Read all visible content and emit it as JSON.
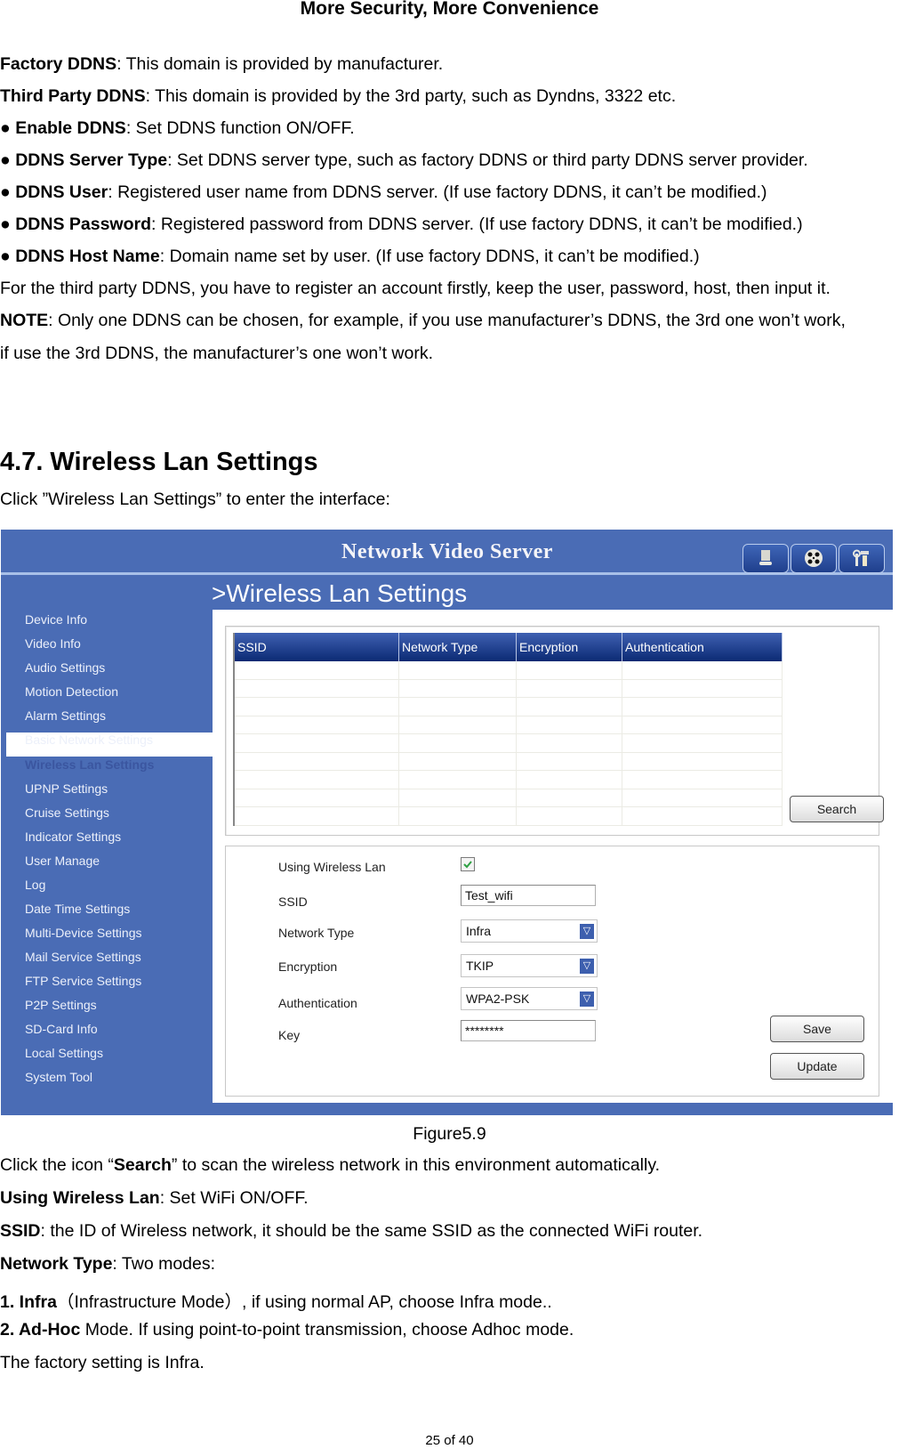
{
  "document": {
    "header": "More Security, More Convenience",
    "intro_paragraphs": [
      {
        "bold": "Factory DDNS",
        "text": ": This domain is provided by manufacturer."
      },
      {
        "bold": "Third Party DDNS",
        "text": ": This domain is provided by the 3rd party, such as Dyndns, 3322 etc."
      },
      {
        "bullet": "●",
        "bold": "Enable DDNS",
        "text": ": Set DDNS function ON/OFF."
      },
      {
        "bullet": "●",
        "bold": "DDNS Server Type",
        "text": ": Set DDNS server type, such as factory DDNS or third party DDNS server provider."
      },
      {
        "bullet": "●",
        "bold": "DDNS User",
        "text": ": Registered user name from DDNS server. (If use factory DDNS, it can’t be modified.)"
      },
      {
        "bullet": "●",
        "bold": "DDNS Password",
        "text": ": Registered password from DDNS server. (If use factory DDNS, it can’t be modified.)"
      },
      {
        "bullet": "●",
        "bold": "DDNS Host Name",
        "text": ": Domain name set by user. (If use factory DDNS, it can’t be modified.)"
      },
      {
        "bold": "",
        "text": "For the third party DDNS, you have to register an account firstly, keep the user, password, host, then input it."
      },
      {
        "bold": "NOTE",
        "text": ": Only one DDNS can be chosen, for example, if you use manufacturer’s DDNS, the 3rd one won’t work,"
      },
      {
        "bold": "",
        "text": "if use the 3rd DDNS, the manufacturer’s one won’t work."
      }
    ],
    "section_heading": "4.7. Wireless Lan Settings",
    "section_intro": "Click ”Wireless Lan Settings” to enter the interface:",
    "figure_caption": "Figure5.9",
    "after_paragraphs": [
      {
        "pre": "Click the icon “",
        "bold": "Search",
        "text": "” to scan the wireless network in this environment automatically."
      },
      {
        "pre": "",
        "bold": "Using Wireless Lan",
        "text": ": Set WiFi ON/OFF."
      },
      {
        "pre": "",
        "bold": "SSID",
        "text": ": the ID of Wireless network, it should be the same SSID as the connected WiFi router."
      },
      {
        "pre": "",
        "bold": "Network Type",
        "text": ": Two modes:"
      },
      {
        "pre": "",
        "bold": "1. Infra",
        "text": "（Infrastructure Mode）, if using normal AP, choose Infra mode.."
      },
      {
        "pre": "",
        "bold": "2. Ad-Hoc",
        "text": " Mode. If using point-to-point transmission, choose Adhoc mode."
      },
      {
        "pre": "",
        "bold": "",
        "text": "The factory setting is Infra."
      }
    ],
    "page_number": "25 of 40"
  },
  "ui": {
    "app_title": "Network Video Server",
    "toolbar_icons": [
      "live-view-icon",
      "playback-reel-icon",
      "settings-tools-icon"
    ],
    "page_title": ">Wireless Lan Settings",
    "sidebar": {
      "active": "Wireless Lan Settings",
      "items": [
        "Device Info",
        "Video Info",
        "Audio Settings",
        "Motion Detection",
        "Alarm Settings",
        "Basic Network Settings",
        "Wireless Lan Settings",
        "UPNP Settings",
        "Cruise Settings",
        "Indicator Settings",
        "User Manage",
        "Log",
        "Date Time Settings",
        "Multi-Device Settings",
        "Mail Service Settings",
        "FTP Service Settings",
        "P2P Settings",
        "SD-Card Info",
        "Local Settings",
        "System Tool"
      ]
    },
    "network_table": {
      "columns": [
        "SSID",
        "Network Type",
        "Encryption",
        "Authentication"
      ],
      "rows": []
    },
    "search_button": "Search",
    "form": {
      "using_wireless_lan": {
        "label": "Using Wireless Lan",
        "checked": true
      },
      "ssid": {
        "label": "SSID",
        "value": "Test_wifi"
      },
      "network_type": {
        "label": "Network Type",
        "value": "Infra"
      },
      "encryption": {
        "label": "Encryption",
        "value": "TKIP"
      },
      "authentication": {
        "label": "Authentication",
        "value": "WPA2-PSK"
      },
      "key": {
        "label": "Key",
        "value": "********"
      }
    },
    "save_button": "Save",
    "update_button": "Update",
    "colors": {
      "sidebar_blue": "#4a6cb5",
      "table_header": "#1a3a85",
      "dropdown_arrow": "#3d5fae"
    }
  }
}
